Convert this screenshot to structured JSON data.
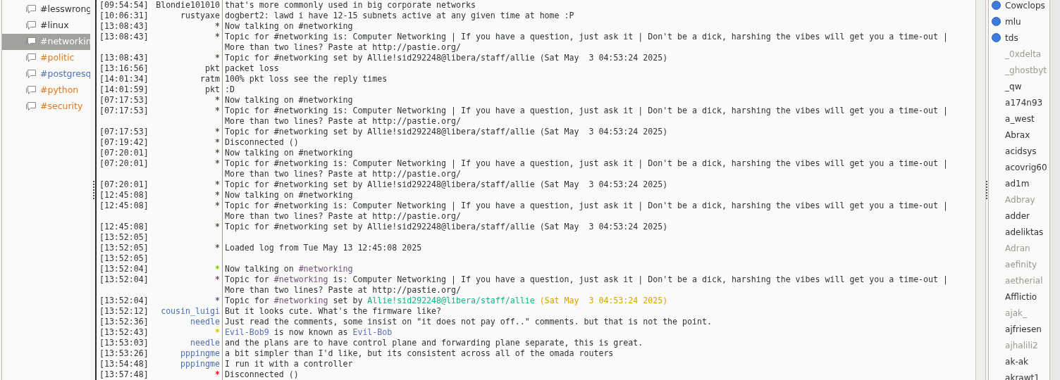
{
  "channels": [
    {
      "name": "#lesswrong",
      "color": "#2e3436",
      "selected": false
    },
    {
      "name": "#linux",
      "color": "#2e3436",
      "selected": false
    },
    {
      "name": "#networkin",
      "selected": true
    },
    {
      "name": "#politic",
      "color": "#e07a1f",
      "selected": false
    },
    {
      "name": "#postgresq",
      "color": "#4d72b8",
      "selected": false
    },
    {
      "name": "#python",
      "color": "#e07a1f",
      "selected": false
    },
    {
      "name": "#security",
      "color": "#e07a1f",
      "selected": false
    }
  ],
  "messages": [
    {
      "time": "[09:54:54]",
      "nick": {
        "text": "Blondie101010",
        "color": "#2e3436"
      },
      "parts": [
        {
          "text": "that's more commonly used in big corporate networks"
        }
      ]
    },
    {
      "time": "[10:06:31]",
      "nick": {
        "text": "rustyaxe",
        "color": "#2e3436"
      },
      "parts": [
        {
          "text": "dogbert2: lawd i have 12-15 subnets active at any given time at home :P"
        }
      ]
    },
    {
      "time": "[13:08:43]",
      "nick": {
        "text": "*",
        "color": "#555753"
      },
      "parts": [
        {
          "text": "Now talking on #networking"
        }
      ]
    },
    {
      "time": "[13:08:43]",
      "nick": {
        "text": "*",
        "color": "#555753"
      },
      "parts": [
        {
          "text": "Topic for #networking is: Computer Networking | If you have a question, just ask it | Don't be a dick, harshing the vibes will get you a time-out | More than two lines? Paste at http://pastie.org/"
        }
      ]
    },
    {
      "time": "[13:08:43]",
      "nick": {
        "text": "*",
        "color": "#555753"
      },
      "parts": [
        {
          "text": "Topic for #networking set by Allie!sid292248@libera/staff/allie (Sat May  3 04:53:24 2025)"
        }
      ]
    },
    {
      "time": "[13:16:56]",
      "nick": {
        "text": "pkt",
        "color": "#2e3436"
      },
      "parts": [
        {
          "text": "packet loss"
        }
      ]
    },
    {
      "time": "[14:01:34]",
      "nick": {
        "text": "ratm",
        "color": "#2e3436"
      },
      "parts": [
        {
          "text": "100% pkt loss see the reply times"
        }
      ]
    },
    {
      "time": "[14:01:59]",
      "nick": {
        "text": "pkt",
        "color": "#2e3436"
      },
      "parts": [
        {
          "text": ":D"
        }
      ]
    },
    {
      "time": "[07:17:53]",
      "nick": {
        "text": "*",
        "color": "#555753"
      },
      "parts": [
        {
          "text": "Now talking on #networking"
        }
      ]
    },
    {
      "time": "[07:17:53]",
      "nick": {
        "text": "*",
        "color": "#555753"
      },
      "parts": [
        {
          "text": "Topic for #networking is: Computer Networking | If you have a question, just ask it | Don't be a dick, harshing the vibes will get you a time-out | More than two lines? Paste at http://pastie.org/"
        }
      ]
    },
    {
      "time": "[07:17:53]",
      "nick": {
        "text": "*",
        "color": "#555753"
      },
      "parts": [
        {
          "text": "Topic for #networking set by Allie!sid292248@libera/staff/allie (Sat May  3 04:53:24 2025)"
        }
      ]
    },
    {
      "time": "[07:19:42]",
      "nick": {
        "text": "*",
        "color": "#555753"
      },
      "parts": [
        {
          "text": "Disconnected ()"
        }
      ]
    },
    {
      "time": "[07:20:01]",
      "nick": {
        "text": "*",
        "color": "#555753"
      },
      "parts": [
        {
          "text": "Now talking on #networking"
        }
      ]
    },
    {
      "time": "[07:20:01]",
      "nick": {
        "text": "*",
        "color": "#555753"
      },
      "parts": [
        {
          "text": "Topic for #networking is: Computer Networking | If you have a question, just ask it | Don't be a dick, harshing the vibes will get you a time-out | More than two lines? Paste at http://pastie.org/"
        }
      ]
    },
    {
      "time": "[07:20:01]",
      "nick": {
        "text": "*",
        "color": "#555753"
      },
      "parts": [
        {
          "text": "Topic for #networking set by Allie!sid292248@libera/staff/allie (Sat May  3 04:53:24 2025)"
        }
      ]
    },
    {
      "time": "[12:45:08]",
      "nick": {
        "text": "*",
        "color": "#555753"
      },
      "parts": [
        {
          "text": "Now talking on #networking"
        }
      ]
    },
    {
      "time": "[12:45:08]",
      "nick": {
        "text": "*",
        "color": "#555753"
      },
      "parts": [
        {
          "text": "Topic for #networking is: Computer Networking | If you have a question, just ask it | Don't be a dick, harshing the vibes will get you a time-out | More than two lines? Paste at http://pastie.org/"
        }
      ]
    },
    {
      "time": "[12:45:08]",
      "nick": {
        "text": "*",
        "color": "#555753"
      },
      "parts": [
        {
          "text": "Topic for #networking set by Allie!sid292248@libera/staff/allie (Sat May  3 04:53:24 2025)"
        }
      ]
    },
    {
      "time": "[13:52:05]"
    },
    {
      "time": "[13:52:05]",
      "nick": {
        "text": "*",
        "color": "#555753"
      },
      "parts": [
        {
          "text": "Loaded log from Tue May 13 12:45:08 2025"
        }
      ]
    },
    {
      "time": "[13:52:05]"
    },
    {
      "time": "[13:52:04]",
      "nick": {
        "text": "*",
        "color": "#73c11d"
      },
      "parts": [
        {
          "text": "Now talking on "
        },
        {
          "text": "#networking",
          "color": "#75507b"
        }
      ]
    },
    {
      "time": "[13:52:04]",
      "nick": {
        "text": "*",
        "color": "#75507b"
      },
      "parts": [
        {
          "text": "Topic for "
        },
        {
          "text": "#networking",
          "color": "#75507b"
        },
        {
          "text": " is: Computer Networking | If you have a question, just ask it | Don't be a dick, harshing the vibes will get you a time-out | More than two lines? Paste at http://pastie.org/"
        }
      ]
    },
    {
      "time": "[13:52:04]",
      "nick": {
        "text": "*",
        "color": "#75507b"
      },
      "parts": [
        {
          "text": "Topic for "
        },
        {
          "text": "#networking",
          "color": "#75507b"
        },
        {
          "text": " set by "
        },
        {
          "text": "Allie!sid292248@libera/staff/allie",
          "color": "#16b08a"
        },
        {
          "text": " (Sat May  3 04:53:24 2025)",
          "color": "#d9a400"
        }
      ]
    },
    {
      "time": "[13:52:12]",
      "nick": {
        "text": "cousin_luigi",
        "color": "#4a6fb8"
      },
      "parts": [
        {
          "text": "But it looks cute. What's the firmware like?"
        }
      ]
    },
    {
      "time": "[13:52:36]",
      "nick": {
        "text": "needle",
        "color": "#4a6fb8"
      },
      "parts": [
        {
          "text": "Just read the comments, some insist on \"it does not pay off..\" comments. but that is not the point."
        }
      ]
    },
    {
      "time": "[13:52:43]",
      "nick": {
        "text": "*",
        "color": "#e6b800"
      },
      "parts": [
        {
          "text": "Evil-Bob9",
          "color": "#5a6ec0"
        },
        {
          "text": " is now known as "
        },
        {
          "text": "Evil-Bob",
          "color": "#5a6ec0"
        }
      ]
    },
    {
      "time": "[13:53:03]",
      "nick": {
        "text": "needle",
        "color": "#4a6fb8"
      },
      "parts": [
        {
          "text": "and the plans are to have control plane and forwarding plane separate, this is great."
        }
      ]
    },
    {
      "time": "[13:53:26]",
      "nick": {
        "text": "pppingme",
        "color": "#4a6fb8"
      },
      "parts": [
        {
          "text": "a bit simpler than I'd like, but its consistent across all of the omada routers"
        }
      ]
    },
    {
      "time": "[13:54:48]",
      "nick": {
        "text": "pppingme",
        "color": "#4a6fb8"
      },
      "parts": [
        {
          "text": "I run it with a controller"
        }
      ]
    },
    {
      "time": "[13:57:48]",
      "nick": {
        "text": "*",
        "color": "#e01b1b"
      },
      "parts": [
        {
          "text": "Disconnected ()"
        }
      ]
    }
  ],
  "users": [
    {
      "name": "Cowclops",
      "op": true,
      "away": false
    },
    {
      "name": "mlu",
      "op": true,
      "away": false
    },
    {
      "name": "tds",
      "op": true,
      "away": false
    },
    {
      "name": "_0xdelta",
      "op": false,
      "away": true
    },
    {
      "name": "_ghostbyt",
      "op": false,
      "away": true
    },
    {
      "name": "_qw",
      "op": false,
      "away": false
    },
    {
      "name": "a174n93",
      "op": false,
      "away": false
    },
    {
      "name": "a_west",
      "op": false,
      "away": false
    },
    {
      "name": "Abrax",
      "op": false,
      "away": false
    },
    {
      "name": "acidsys",
      "op": false,
      "away": false
    },
    {
      "name": "acovrig60",
      "op": false,
      "away": false
    },
    {
      "name": "ad1m",
      "op": false,
      "away": false
    },
    {
      "name": "Adbray",
      "op": false,
      "away": true
    },
    {
      "name": "adder",
      "op": false,
      "away": false
    },
    {
      "name": "adeliktas",
      "op": false,
      "away": false
    },
    {
      "name": "Adran",
      "op": false,
      "away": true
    },
    {
      "name": "aefinity",
      "op": false,
      "away": true
    },
    {
      "name": "aetherial",
      "op": false,
      "away": true
    },
    {
      "name": "Afflictio",
      "op": false,
      "away": false
    },
    {
      "name": "ajak_",
      "op": false,
      "away": true
    },
    {
      "name": "ajfriesen",
      "op": false,
      "away": false
    },
    {
      "name": "ajhalili2",
      "op": false,
      "away": true
    },
    {
      "name": "ak-ak",
      "op": false,
      "away": false
    },
    {
      "name": "akrawt1",
      "op": false,
      "away": false
    }
  ]
}
